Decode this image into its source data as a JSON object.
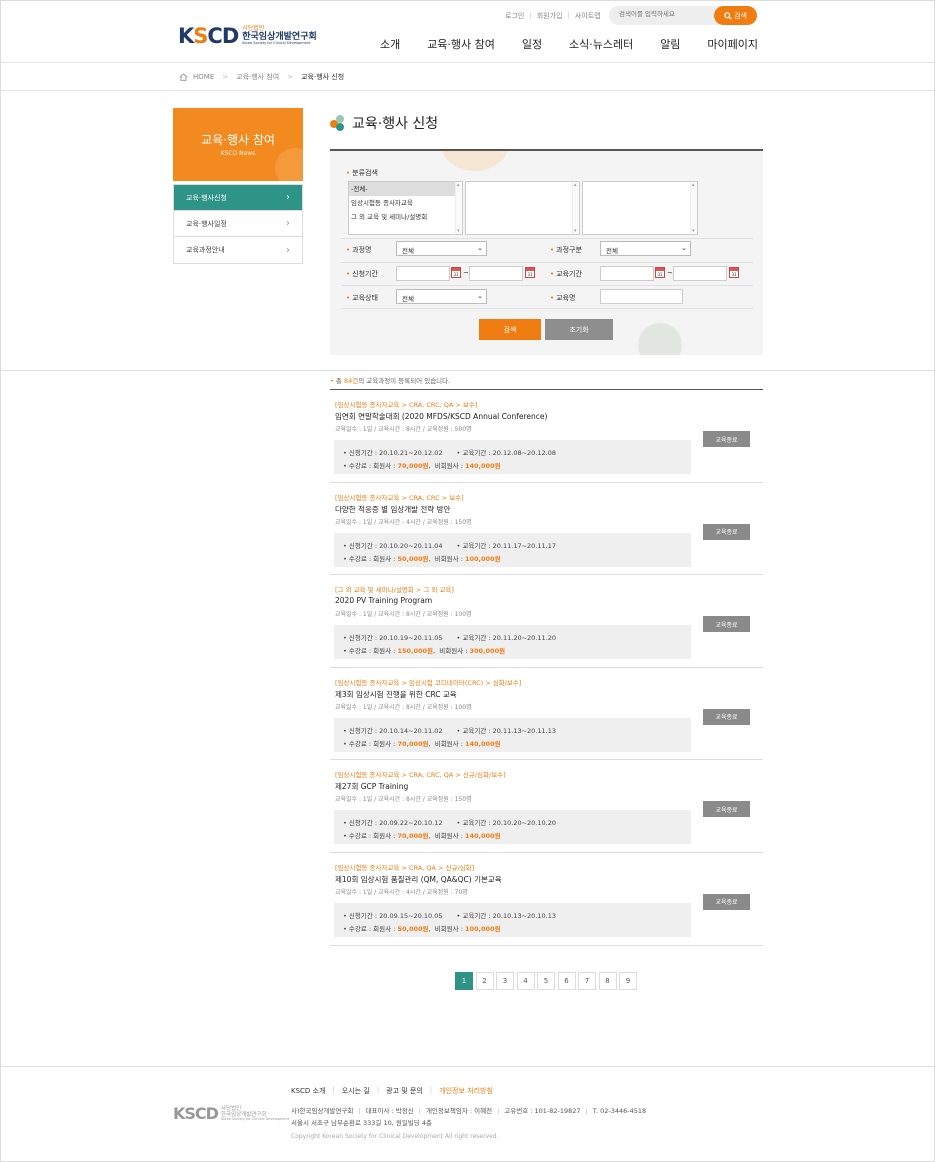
{
  "header": {
    "logo_mark": "KSCD",
    "logo_sub": "사단법인",
    "logo_main": "한국임상개발연구회",
    "logo_en": "Korea Society for Clinical Development",
    "top_links": [
      "로그인",
      "회원가입",
      "사이트맵"
    ],
    "search_placeholder": "검색어를 입력하세요",
    "search_button": "검색",
    "nav": [
      "소개",
      "교육·행사 참여",
      "일정",
      "소식·뉴스레터",
      "알림",
      "마이페이지"
    ]
  },
  "breadcrumb": {
    "home": "HOME",
    "level1": "교육·행사 참여",
    "level2": "교육·행사 신청"
  },
  "sidebar": {
    "title": "교육·행사 참여",
    "subtitle": "KSCD News",
    "items": [
      "교육·행사신청",
      "교육·행사일정",
      "교육과정안내"
    ]
  },
  "page_title": "교육·행사 신청",
  "filters": {
    "category_label": "분류검색",
    "category_options": [
      "-전체-",
      "임상시험등 종사자교육",
      "그 외 교육 및 세미나/설명회"
    ],
    "course_label": "과정명",
    "course_value": "전체",
    "course_type_label": "과정구분",
    "course_type_value": "전체",
    "apply_period_label": "신청기간",
    "edu_period_label": "교육기간",
    "status_label": "교육상태",
    "status_value": "전체",
    "edu_name_label": "교육명",
    "calendar_text": "31",
    "tilde": "~",
    "search_button": "검색",
    "reset_button": "초기화"
  },
  "total": {
    "prefix": "총 ",
    "count": "84건",
    "suffix": "의 교육과정이 등록되어 있습니다."
  },
  "labels": {
    "apply": "• 신청기간 : ",
    "edu": "• 교육기간 : ",
    "fee": "• 수강료 : 회원사 : ",
    "nonmember": "비회원사 : "
  },
  "courses": [
    {
      "category": "[임상시험등 종사자교육 > CRA, CRC, QA > 보수]",
      "title": "임연회 연말학술대회 (2020 MFDS/KSCD Annual Conference)",
      "meta": "교육일수 : 1일  /  교육시간 : 8시간  /  교육정원 : 500명",
      "apply": "20.10.21~20.12.02",
      "edu": "20.12.08~20.12.08",
      "member_fee": "70,000원",
      "nonmember_fee": "140,000원",
      "status": "교육종료"
    },
    {
      "category": "[임상시험등 종사자교육 > CRA, CRC > 보수]",
      "title": "다양한 적응증 별 임상개발 전략 방안",
      "meta": "교육일수 : 1일  /  교육시간 : 4시간  /  교육정원 : 150명",
      "apply": "20.10.20~20.11.04",
      "edu": "20.11.17~20.11.17",
      "member_fee": "50,000원",
      "nonmember_fee": "100,000원",
      "status": "교육종료"
    },
    {
      "category": "[그 외 교육 및 세미나/설명회 > 그 외 교육]",
      "title": "2020 PV Training Program",
      "meta": "교육일수 : 1일  /  교육시간 : 8시간  /  교육정원 : 100명",
      "apply": "20.10.19~20.11.05",
      "edu": "20.11.20~20.11.20",
      "member_fee": "150,000원",
      "nonmember_fee": "300,000원",
      "status": "교육종료"
    },
    {
      "category": "[임상시험등 종사자교육 > 임상시험 코디네이터(CRC) > 심화/보수]",
      "title": "제3회 임상시험 진행을 위한 CRC 교육",
      "meta": "교육일수 : 1일  /  교육시간 : 8시간  /  교육정원 : 100명",
      "apply": "20.10.14~20.11.02",
      "edu": "20.11.13~20.11.13",
      "member_fee": "70,000원",
      "nonmember_fee": "140,000원",
      "status": "교육종료"
    },
    {
      "category": "[임상시험등 종사자교육 > CRA, CRC, QA > 신규/심화/보수]",
      "title": "제27회 GCP Training",
      "meta": "교육일수 : 1일  /  교육시간 : 8시간  /  교육정원 : 150명",
      "apply": "20.09.22~20.10.12",
      "edu": "20.10.20~20.10.20",
      "member_fee": "70,000원",
      "nonmember_fee": "140,000원",
      "status": "교육종료"
    },
    {
      "category": "[임상시험등 종사자교육 > CRA, QA > 신규/심화]",
      "title": "제10회 임상시험 품질관리 (QM, QA&QC) 기본교육",
      "meta": "교육일수 : 1일  /  교육시간 : 4시간  /  교육정원 : 70명",
      "apply": "20.09.15~20.10.05",
      "edu": "20.10.13~20.10.13",
      "member_fee": "50,000원",
      "nonmember_fee": "100,000원",
      "status": "교육종료"
    }
  ],
  "pagination": [
    "1",
    "2",
    "3",
    "4",
    "5",
    "6",
    "7",
    "8",
    "9"
  ],
  "footer": {
    "links": [
      "KSCD 소개",
      "오시는 길",
      "광고 및 문의",
      "개인정보 처리방침"
    ],
    "logo_mark": "KSCD",
    "logo_sub": "사단법인",
    "logo_main": "한국임상개발연구회",
    "logo_en": "Korea Society for Clinical Development",
    "address1": [
      "사)한국임상개발연구회",
      "대표이사 : 박정신",
      "개인정보책임자 : 이혜전",
      "고유번호 : 101-82-19827",
      "T. 02-3446-4518"
    ],
    "address2": "서울시 서초구 남부순환로 333길 10, 원일빌딩 4층",
    "copyright": "Copyright Korean Society for Clinical Development All right reserved."
  },
  "colors": {
    "accent": "#f07d12",
    "teal": "#2e9488",
    "navy": "#1f3a6b"
  }
}
